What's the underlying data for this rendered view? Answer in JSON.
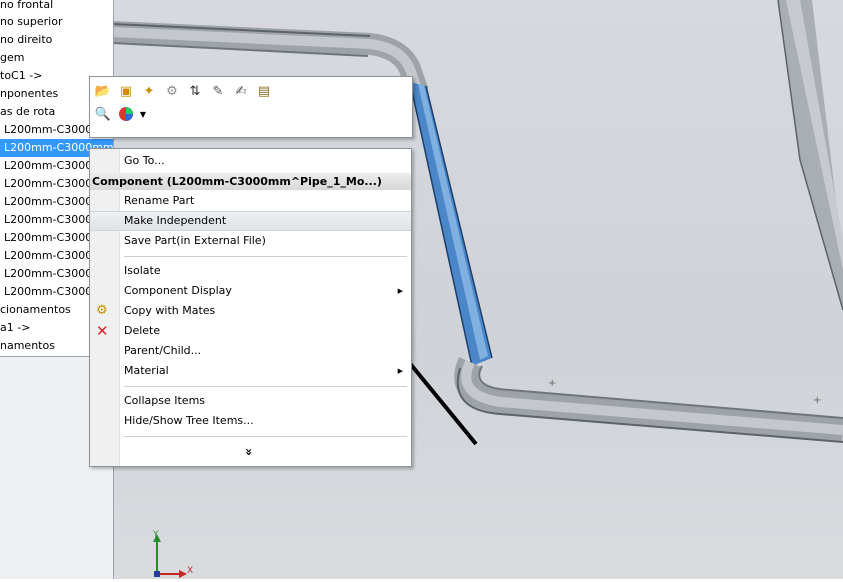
{
  "tree": {
    "items": [
      {
        "label": "no frontal"
      },
      {
        "label": "no superior"
      },
      {
        "label": "no direito"
      },
      {
        "label": "gem"
      },
      {
        "label": "toC1 ->"
      },
      {
        "label": "nponentes"
      },
      {
        "label": "as de rota"
      },
      {
        "label": "L200mm-C3000"
      },
      {
        "label": "L200mm-C3000mm"
      },
      {
        "label": "L200mm-C3000"
      },
      {
        "label": "L200mm-C3000"
      },
      {
        "label": "L200mm-C3000"
      },
      {
        "label": "L200mm-C3000"
      },
      {
        "label": "L200mm-C3000"
      },
      {
        "label": "L200mm-C3000"
      },
      {
        "label": "L200mm-C3000"
      },
      {
        "label": "L200mm-C3000"
      },
      {
        "label": "cionamentos"
      },
      {
        "label": "a1 ->"
      },
      {
        "label": "namentos"
      }
    ]
  },
  "toolbar": {
    "row1": [
      "open-part-icon",
      "edit-component-icon",
      "component-properties-icon",
      "appearance-icon",
      "sort-icon",
      "attach-icon",
      "sketch-icon",
      "document-properties-icon"
    ],
    "row2": [
      "zoom-to-selection-icon",
      "appearance-color-icon"
    ]
  },
  "menu": {
    "goto": "Go To...",
    "header": "Component (L200mm-C3000mm^Pipe_1_Mo...)",
    "rename": "Rename Part",
    "make_independent": "Make Independent",
    "save_part": "Save Part(in External File)",
    "isolate": "Isolate",
    "component_display": "Component Display",
    "copy_with_mates": "Copy with Mates",
    "delete": "Delete",
    "parent_child": "Parent/Child...",
    "material": "Material",
    "collapse_items": "Collapse Items",
    "hide_show_tree": "Hide/Show Tree Items...",
    "more": "»"
  },
  "axes": {
    "y": "Y",
    "x": "X"
  },
  "colors": {
    "selection": "#3399ff",
    "highlight_pipe": "#4a86c8",
    "delete_icon": "#d9262b"
  }
}
